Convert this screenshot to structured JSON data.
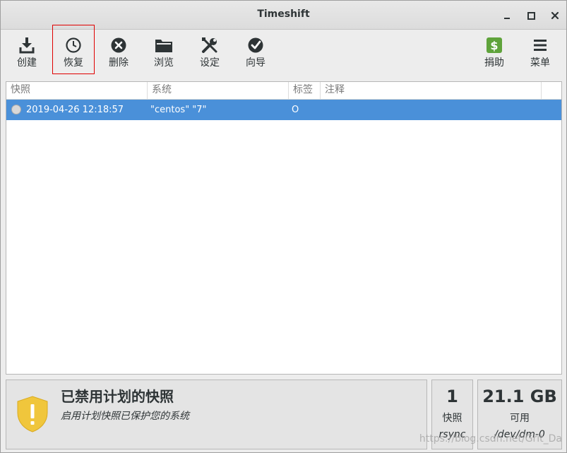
{
  "window": {
    "title": "Timeshift"
  },
  "toolbar": {
    "create": "创建",
    "restore": "恢复",
    "delete": "删除",
    "browse": "浏览",
    "settings": "设定",
    "wizard": "向导",
    "donate": "捐助",
    "menu": "菜单"
  },
  "table": {
    "columns": [
      "快照",
      "系统",
      "标签",
      "注释"
    ],
    "rows": [
      {
        "snapshot": "2019-04-26 12:18:57",
        "system": "\"centos\" \"7\"",
        "tags": "O",
        "comment": ""
      }
    ]
  },
  "status": {
    "title": "已禁用计划的快照",
    "subtitle": "启用计划快照已保护您的系统"
  },
  "stats": {
    "snapshots": {
      "count": "1",
      "label": "快照",
      "sub": "rsync"
    },
    "space": {
      "value": "21.1 GB",
      "label": "可用",
      "sub": "/dev/dm-0"
    }
  },
  "watermark": "https://blog.csdn.net/Grit_Da",
  "colors": {
    "selection": "#4a90d9",
    "shield": "#f0c63c",
    "donate": "#5fa33b",
    "highlight_border": "#e00000"
  }
}
